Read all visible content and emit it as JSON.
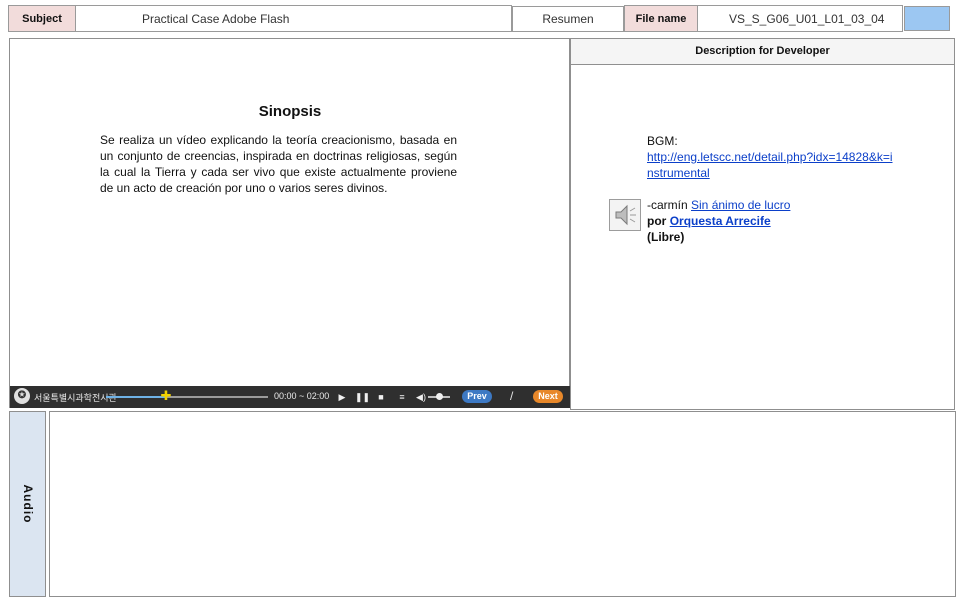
{
  "header": {
    "subject_label": "Subject",
    "subject_value": "Practical Case Adobe Flash",
    "section_tab": "Resumen",
    "file_name_label": "File name",
    "file_name_value": "VS_S_G06_U01_L01_03_04"
  },
  "content": {
    "title": "Sinopsis",
    "body": "Se realiza un vídeo explicando la teoría creacionismo, basada en un conjunto de creencias, inspirada en doctrinas religiosas, según la cual la Tierra y cada ser vivo que existe actualmente proviene de un acto de creación por uno o varios seres divinos."
  },
  "player": {
    "org_name": "서울특별시과학전시관",
    "time": "00:00 ~ 02:00",
    "progress_fraction": 0.37,
    "volume_fraction": 0.5,
    "prev_label": "Prev",
    "separator": "/",
    "next_label": "Next"
  },
  "developer": {
    "heading": "Description for Developer",
    "bgm_label": "BGM:",
    "bgm_url": "http://eng.letscc.net/detail.php?idx=14828&k=instrumental",
    "track_prefix": "-carmín",
    "track_link": "Sin ánimo de lucro",
    "by_label": "por",
    "artist_link": "Orquesta Arrecife",
    "license": "(Libre)"
  },
  "audio": {
    "label": "Audio"
  },
  "icons": {
    "speaker": "speaker-icon",
    "logo": "logo-icon",
    "play": "play-icon",
    "pause": "pause-icon",
    "stop": "stop-icon",
    "menu": "menu-icon",
    "volume": "volume-icon",
    "knob": "seek-knob-icon"
  },
  "colors": {
    "header_label_bg": "#f2dcdb",
    "audio_label_bg": "#dbe5f1",
    "file_accent": "#9cc7f2",
    "link": "#0b3fc9",
    "prev_button": "#3d79c4",
    "next_button": "#e8882a"
  }
}
